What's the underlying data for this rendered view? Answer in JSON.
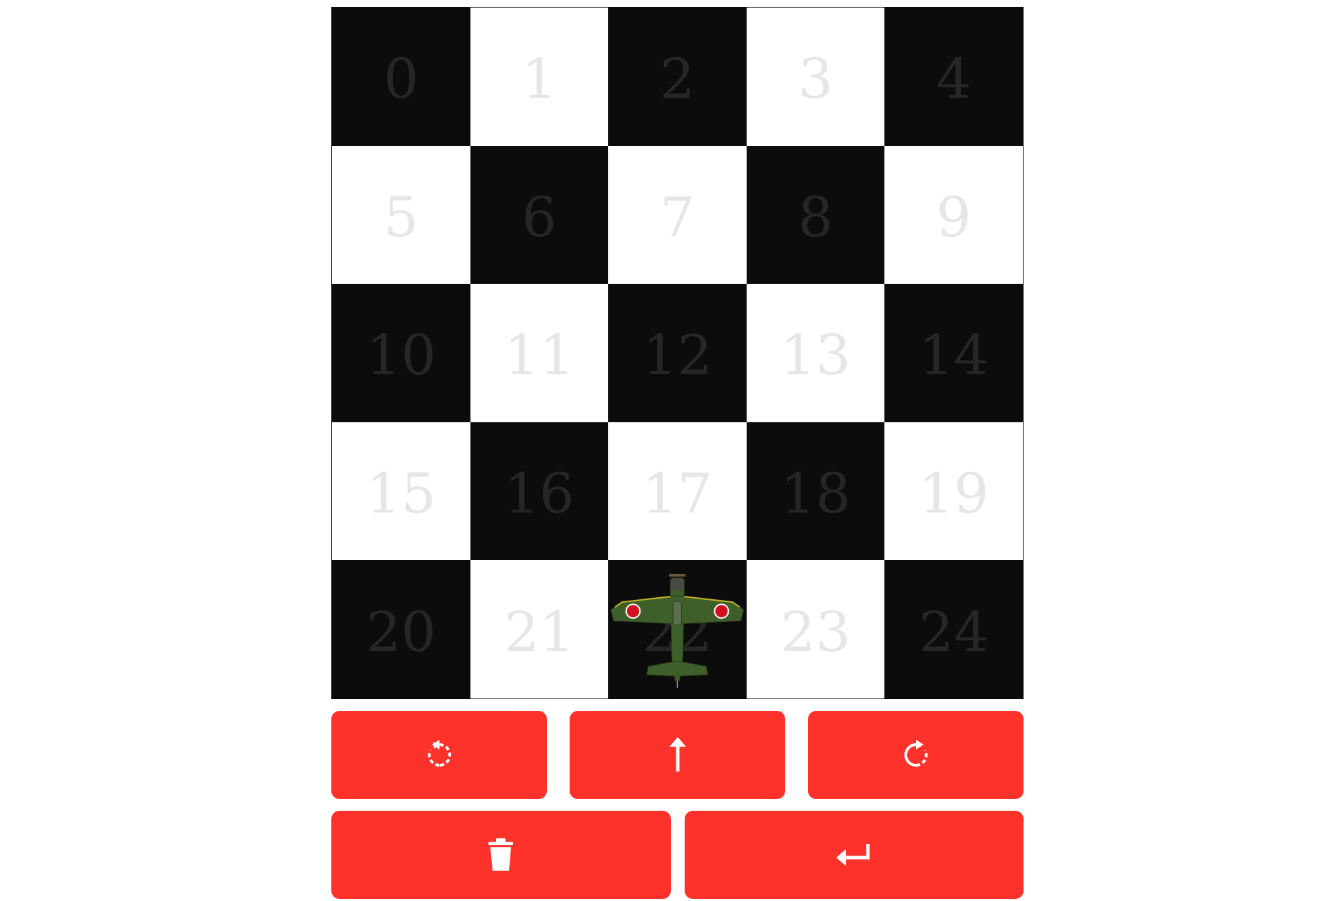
{
  "board": {
    "rows": 5,
    "cols": 5,
    "cells": [
      "0",
      "1",
      "2",
      "3",
      "4",
      "5",
      "6",
      "7",
      "8",
      "9",
      "10",
      "11",
      "12",
      "13",
      "14",
      "15",
      "16",
      "17",
      "18",
      "19",
      "20",
      "21",
      "22",
      "23",
      "24"
    ],
    "plane_cell": 22,
    "plane_heading": "up"
  },
  "controls": {
    "rotate_left": {
      "icon": "rotate-left-icon"
    },
    "forward": {
      "icon": "arrow-up-icon"
    },
    "rotate_right": {
      "icon": "rotate-right-icon"
    },
    "delete": {
      "icon": "trash-icon"
    },
    "enter": {
      "icon": "enter-return-icon"
    }
  },
  "colors": {
    "dark_square": "#0c0c0c",
    "light_square": "#ffffff",
    "button": "#ff312b",
    "plane_body": "#3f5f2a",
    "roundel": "#d0101e"
  }
}
